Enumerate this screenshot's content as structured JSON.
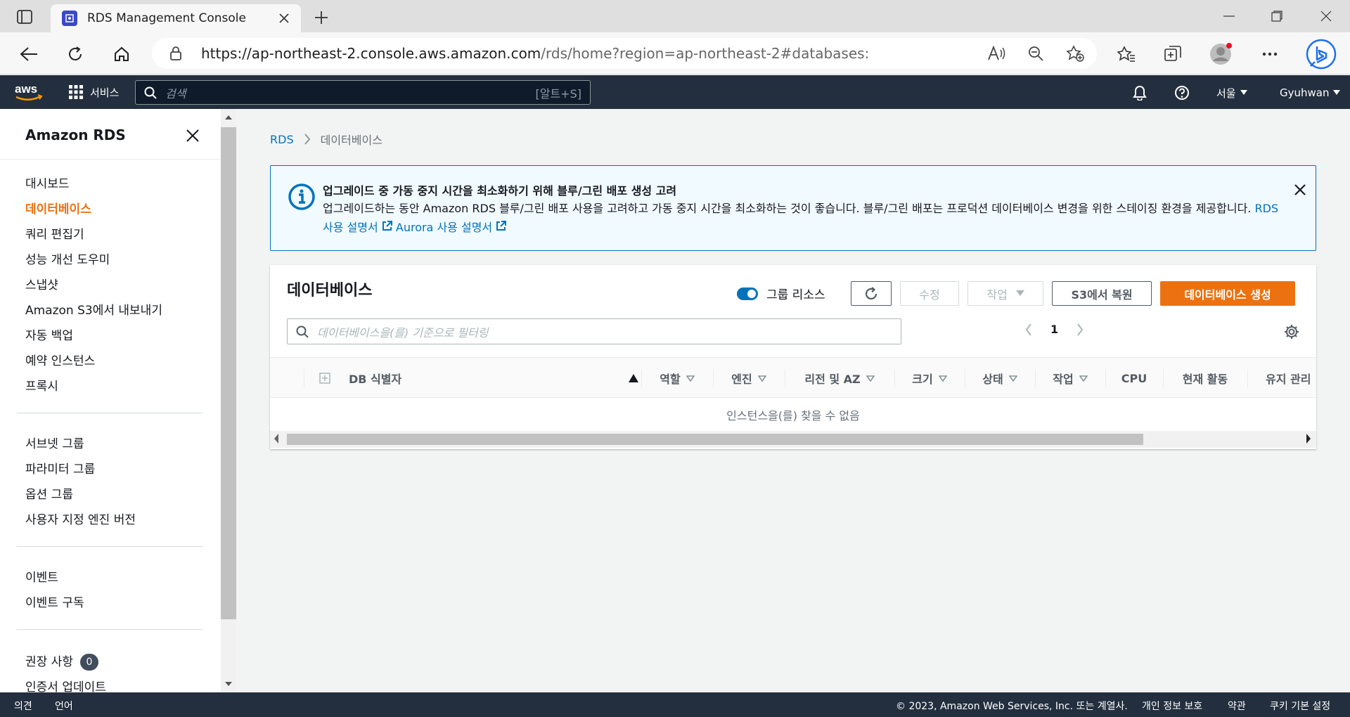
{
  "browser": {
    "tab_title": "RDS Management Console",
    "url_host": "https://ap-northeast-2.console.aws.amazon.com",
    "url_path": "/rds/home?region=ap-northeast-2#databases:"
  },
  "aws_nav": {
    "services_label": "서비스",
    "search_placeholder": "검색",
    "search_shortcut": "[알트+S]",
    "region_label": "서울",
    "user_label": "Gyuhwan"
  },
  "sidebar": {
    "title": "Amazon RDS",
    "group1": [
      "대시보드",
      "데이터베이스",
      "쿼리 편집기",
      "성능 개선 도우미",
      "스냅샷",
      "Amazon S3에서 내보내기",
      "자동 백업",
      "예약 인스턴스",
      "프록시"
    ],
    "group2": [
      "서브넷 그룹",
      "파라미터 그룹",
      "옵션 그룹",
      "사용자 지정 엔진 버전"
    ],
    "group3": [
      "이벤트",
      "이벤트 구독"
    ],
    "group4": [
      "권장 사항",
      "인증서 업데이트"
    ],
    "recommendations_count": "0"
  },
  "breadcrumb": {
    "root": "RDS",
    "current": "데이터베이스"
  },
  "flash": {
    "title": "업그레이드 중 가동 중지 시간을 최소화하기 위해 블루/그린 배포 생성 고려",
    "body": "업그레이드하는 동안 Amazon RDS 블루/그린 배포 사용을 고려하고 가동 중지 시간을 최소화하는 것이 좋습니다. 블루/그린 배포는 프로덕션 데이터베이스 변경을 위한 스테이징 환경을 제공합니다.",
    "link_rds": "RDS 사용 설명서",
    "link_aurora": "Aurora 사용 설명서"
  },
  "panel": {
    "title": "데이터베이스",
    "group_resources_label": "그룹 리소스",
    "modify_label": "수정",
    "actions_label": "작업",
    "restore_s3_label": "S3에서 복원",
    "create_label": "데이터베이스 생성",
    "filter_placeholder": "데이터베이스을(를) 기준으로 필터링",
    "page_number": "1",
    "empty_text": "인스턴스을(를) 찾을 수 없음",
    "columns": [
      "DB 식별자",
      "역할",
      "엔진",
      "리전 및 AZ",
      "크기",
      "상태",
      "작업",
      "CPU",
      "현재 활동",
      "유지 관리"
    ]
  },
  "footer": {
    "feedback": "의견",
    "language": "언어",
    "copyright": "© 2023, Amazon Web Services, Inc. 또는 계열사.",
    "privacy": "개인 정보 보호",
    "terms": "약관",
    "cookies": "쿠키 기본 설정"
  },
  "colors": {
    "aws_nav_bg": "#232f3e",
    "accent_orange": "#ec7211",
    "link_blue": "#0073bb"
  }
}
